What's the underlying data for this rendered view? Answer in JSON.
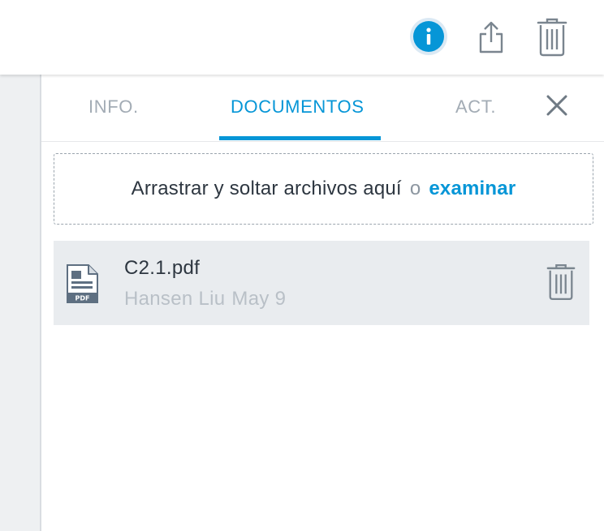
{
  "toolbar": {
    "info_icon": "info-icon",
    "share_icon": "share-icon",
    "trash_icon": "trash-icon",
    "info_glyph": "i"
  },
  "tabs": [
    {
      "label": "INFO.",
      "active": false
    },
    {
      "label": "DOCUMENTOS",
      "active": true
    },
    {
      "label": "ACT.",
      "active": false
    }
  ],
  "close_icon": "close-icon",
  "dropzone": {
    "text": "Arrastrar y soltar archivos aquí",
    "or": "o",
    "link": "examinar"
  },
  "files": [
    {
      "name": "C2.1.pdf",
      "author": "Hansen Liu",
      "date": "May 9",
      "icon_label": "PDF",
      "icon": "pdf-file-icon"
    }
  ],
  "colors": {
    "accent": "#0696d7",
    "muted": "#a3acb5",
    "row_bg": "#e9ecef",
    "text": "#2d3640"
  }
}
